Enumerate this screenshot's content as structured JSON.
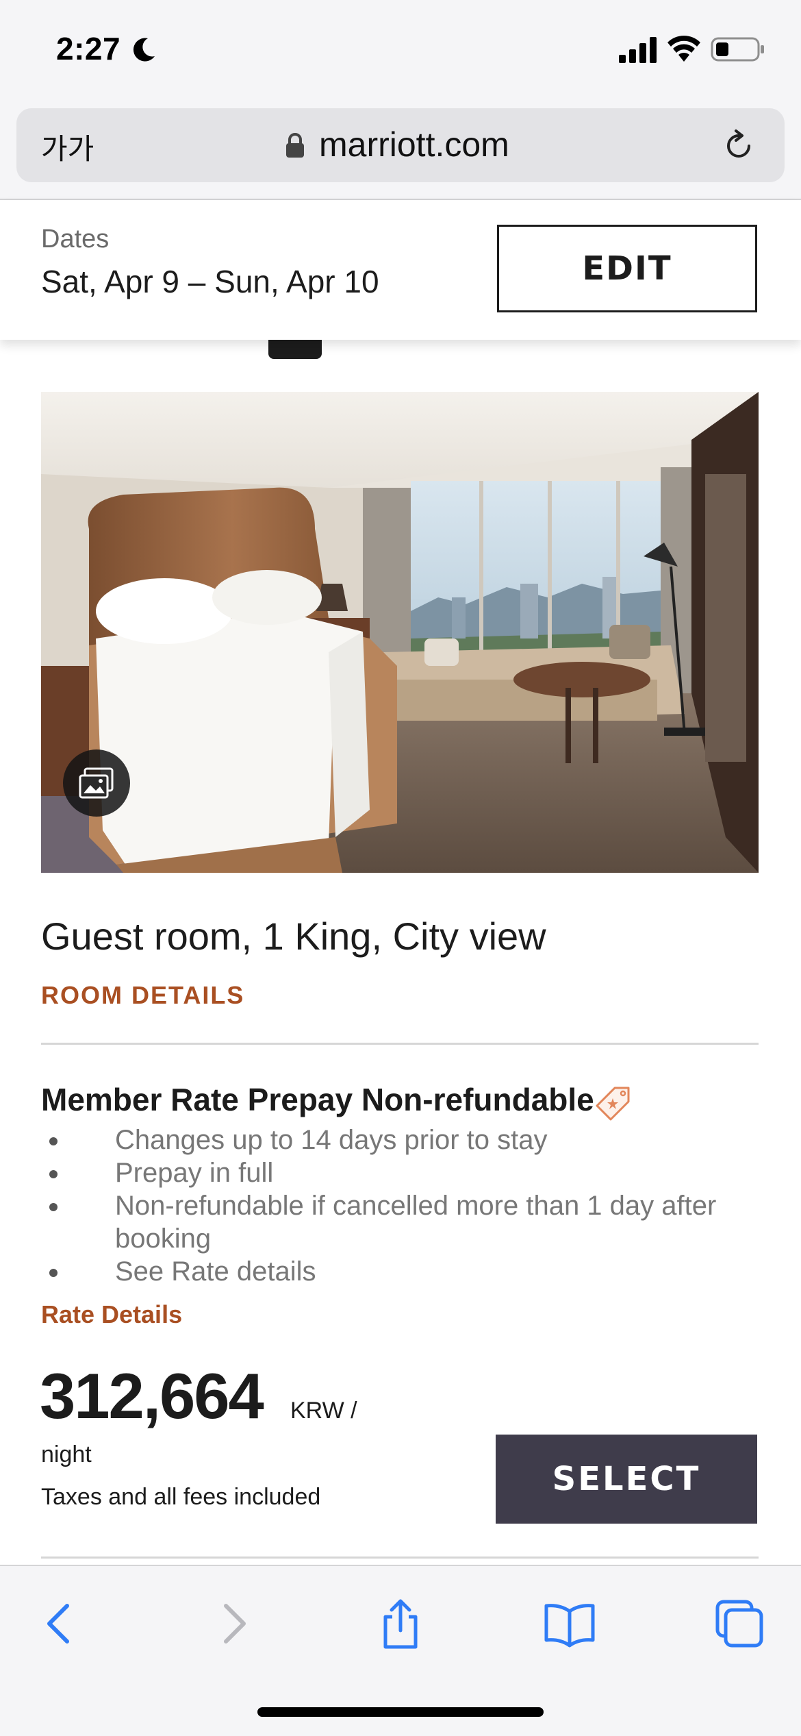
{
  "status_bar": {
    "time": "2:27",
    "icons": [
      "moon-icon",
      "signal-icon",
      "wifi-icon",
      "battery-icon"
    ]
  },
  "url_bar": {
    "text_size_label": "가가",
    "domain": "marriott.com",
    "icons": [
      "lock-icon",
      "reload-icon"
    ]
  },
  "dates": {
    "label": "Dates",
    "value": "Sat, Apr 9 – Sun, Apr 10",
    "edit_label": "EDIT"
  },
  "room": {
    "title": "Guest room, 1 King, City view",
    "details_link": "ROOM DETAILS"
  },
  "rate": {
    "title": "Member Rate Prepay Non-refundable",
    "bullets": [
      "Changes up to 14 days prior to stay",
      "Prepay in full",
      "Non-refundable if cancelled more than 1 day after booking",
      "See Rate details"
    ],
    "details_link": "Rate Details",
    "price": "312,664",
    "currency": "KRW /",
    "per": "night",
    "taxes_note": "Taxes and all fees included",
    "select_label": "SELECT"
  },
  "toolbar": {
    "icons": [
      "back-icon",
      "forward-icon",
      "share-icon",
      "bookmarks-icon",
      "tabs-icon"
    ]
  },
  "colors": {
    "accent": "#a94f22",
    "select_button": "#3f3c4b",
    "ios_blue": "#2f7cf6"
  }
}
